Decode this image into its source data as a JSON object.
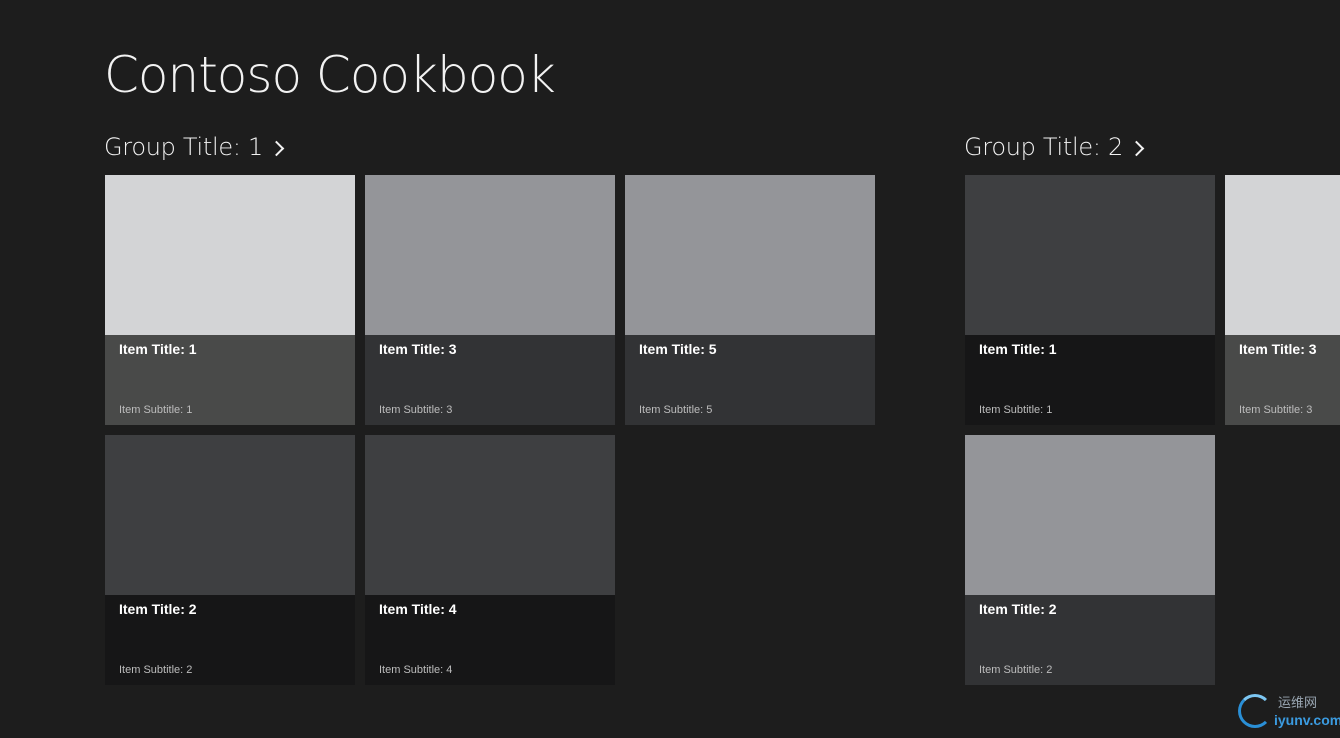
{
  "app": {
    "title": "Contoso Cookbook"
  },
  "groups": [
    {
      "title": "Group Title: 1",
      "items": [
        {
          "title": "Item Title: 1",
          "subtitle": "Item Subtitle: 1",
          "image_color": "#d3d4d6",
          "overlay_color": "#494a49"
        },
        {
          "title": "Item Title: 2",
          "subtitle": "Item Subtitle: 2",
          "image_color": "#3e3f41",
          "overlay_color": "#161617"
        },
        {
          "title": "Item Title: 3",
          "subtitle": "Item Subtitle: 3",
          "image_color": "#949599",
          "overlay_color": "#323335"
        },
        {
          "title": "Item Title: 4",
          "subtitle": "Item Subtitle: 4",
          "image_color": "#3e3f41",
          "overlay_color": "#161617"
        },
        {
          "title": "Item Title: 5",
          "subtitle": "Item Subtitle: 5",
          "image_color": "#949599",
          "overlay_color": "#323335"
        }
      ]
    },
    {
      "title": "Group Title: 2",
      "items": [
        {
          "title": "Item Title: 1",
          "subtitle": "Item Subtitle: 1",
          "image_color": "#3e3f41",
          "overlay_color": "#161617"
        },
        {
          "title": "Item Title: 2",
          "subtitle": "Item Subtitle: 2",
          "image_color": "#949599",
          "overlay_color": "#323335"
        },
        {
          "title": "Item Title: 3",
          "subtitle": "Item Subtitle: 3",
          "image_color": "#d3d4d6",
          "overlay_color": "#494a49"
        }
      ]
    }
  ],
  "watermark": {
    "text_cn": "运维网",
    "domain": "iyunv.com"
  },
  "colors": {
    "background": "#1d1d1d",
    "accent": "#2a8fd6"
  }
}
